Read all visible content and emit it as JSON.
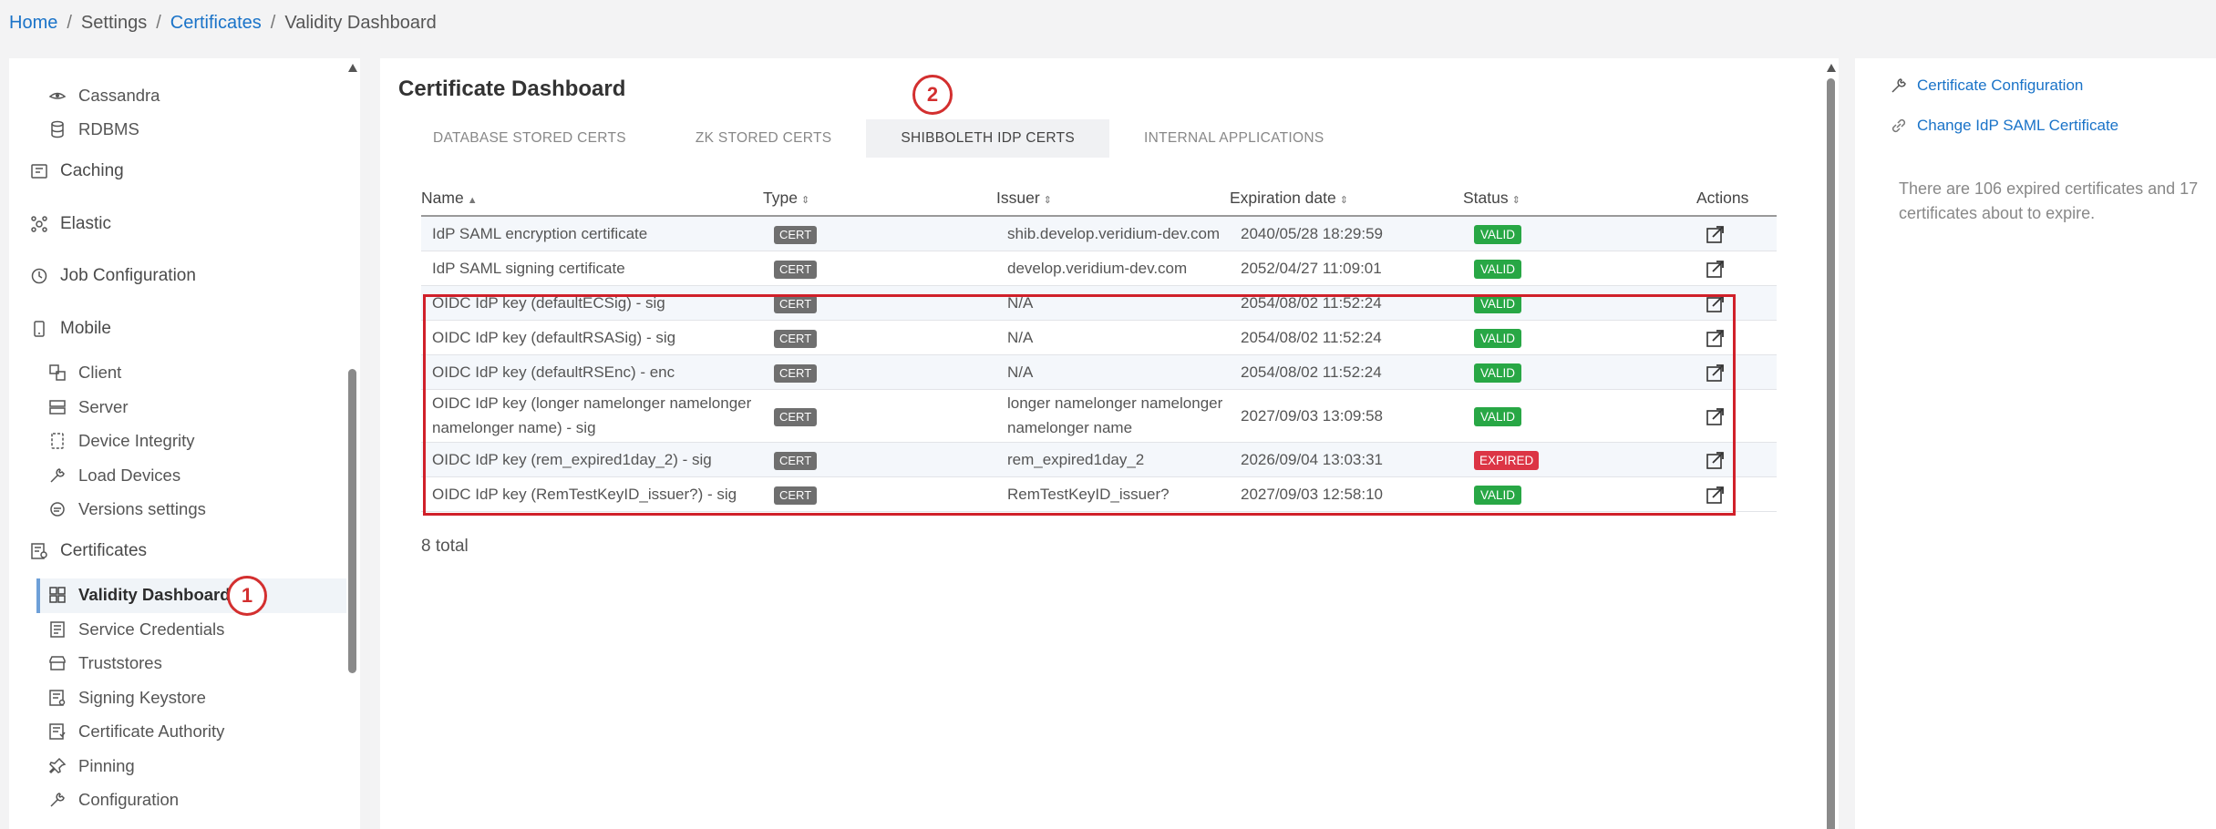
{
  "breadcrumb": {
    "items": [
      "Home",
      "Settings",
      "Certificates",
      "Validity Dashboard"
    ],
    "sep": "/"
  },
  "sidebar": {
    "cassandra": "Cassandra",
    "rdbms": "RDBMS",
    "caching": "Caching",
    "elastic": "Elastic",
    "job_configuration": "Job Configuration",
    "mobile": "Mobile",
    "client": "Client",
    "server": "Server",
    "device_integrity": "Device Integrity",
    "load_devices": "Load Devices",
    "versions_settings": "Versions settings",
    "certificates": "Certificates",
    "validity_dashboard": "Validity Dashboard",
    "service_credentials": "Service Credentials",
    "truststores": "Truststores",
    "signing_keystore": "Signing Keystore",
    "certificate_authority": "Certificate Authority",
    "pinning": "Pinning",
    "configuration": "Configuration"
  },
  "annotations": {
    "one": "1",
    "two": "2"
  },
  "main": {
    "title": "Certificate Dashboard",
    "tabs": [
      "DATABASE STORED CERTS",
      "ZK STORED CERTS",
      "SHIBBOLETH IDP CERTS",
      "INTERNAL APPLICATIONS"
    ],
    "columns": [
      "Name",
      "Type",
      "Issuer",
      "Expiration date",
      "Status",
      "Actions"
    ],
    "sort_asc": "▲",
    "sort_both": "⇕",
    "rows": [
      {
        "name": "IdP SAML encryption certificate",
        "type": "CERT",
        "issuer": "shib.develop.veridium-dev.com",
        "expiration": "2040/05/28 18:29:59",
        "status": "VALID"
      },
      {
        "name": "IdP SAML signing certificate",
        "type": "CERT",
        "issuer": "develop.veridium-dev.com",
        "expiration": "2052/04/27 11:09:01",
        "status": "VALID"
      },
      {
        "name": "OIDC IdP key (defaultECSig) - sig",
        "type": "CERT",
        "issuer": "N/A",
        "expiration": "2054/08/02 11:52:24",
        "status": "VALID"
      },
      {
        "name": "OIDC IdP key (defaultRSASig) - sig",
        "type": "CERT",
        "issuer": "N/A",
        "expiration": "2054/08/02 11:52:24",
        "status": "VALID"
      },
      {
        "name": "OIDC IdP key (defaultRSEnc) - enc",
        "type": "CERT",
        "issuer": "N/A",
        "expiration": "2054/08/02 11:52:24",
        "status": "VALID"
      },
      {
        "name": "OIDC IdP key (longer namelonger namelonger namelonger name) - sig",
        "type": "CERT",
        "issuer": "longer namelonger namelonger namelonger name",
        "expiration": "2027/09/03 13:09:58",
        "status": "VALID"
      },
      {
        "name": "OIDC IdP key (rem_expired1day_2) - sig",
        "type": "CERT",
        "issuer": "rem_expired1day_2",
        "expiration": "2026/09/04 13:03:31",
        "status": "EXPIRED"
      },
      {
        "name": "OIDC IdP key (RemTestKeyID_issuer?) - sig",
        "type": "CERT",
        "issuer": "RemTestKeyID_issuer?",
        "expiration": "2027/09/03 12:58:10",
        "status": "VALID"
      }
    ],
    "total": "8 total"
  },
  "right": {
    "links": [
      "Certificate Configuration",
      "Change IdP SAML Certificate"
    ],
    "note": "There are 106 expired certificates and 17 certificates about to expire."
  },
  "colors": {
    "link": "#1a73c8",
    "valid": "#28a745",
    "expired": "#dc3545",
    "annotation": "#d0202a"
  }
}
